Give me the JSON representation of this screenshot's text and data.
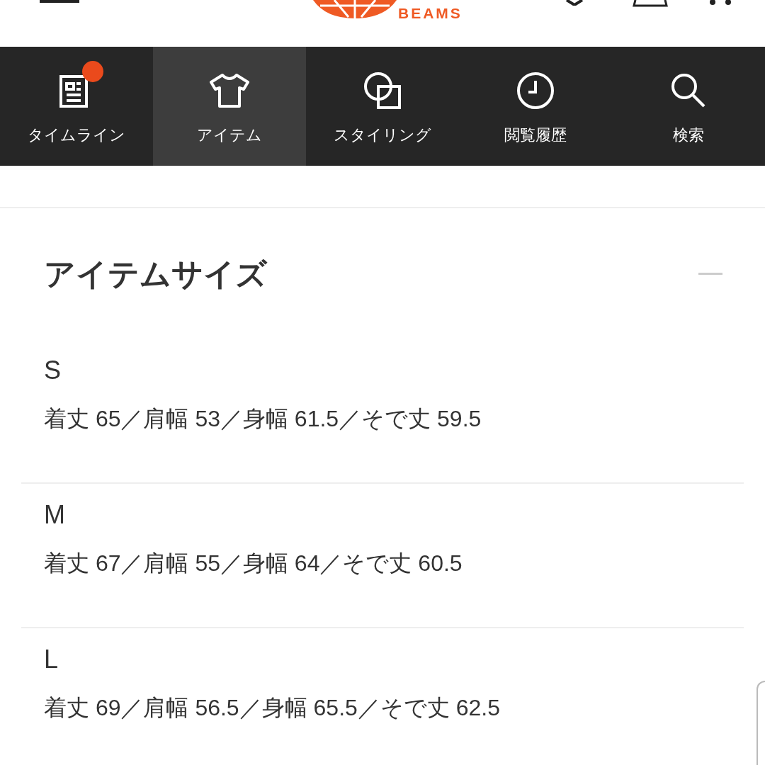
{
  "header": {
    "logo_text": "BEAMS"
  },
  "nav_tabs": [
    {
      "label": "タイムライン",
      "kind": "timeline",
      "selected": false,
      "badge": true
    },
    {
      "label": "アイテム",
      "kind": "item",
      "selected": true,
      "badge": false
    },
    {
      "label": "スタイリング",
      "kind": "styling",
      "selected": false,
      "badge": false
    },
    {
      "label": "閲覧履歴",
      "kind": "history",
      "selected": false,
      "badge": false
    },
    {
      "label": "検索",
      "kind": "search",
      "selected": false,
      "badge": false
    }
  ],
  "size_section": {
    "title": "アイテムサイズ",
    "expanded": true,
    "sizes": [
      {
        "name": "S",
        "measurements": "着丈 65／肩幅 53／身幅 61.5／そで丈 59.5"
      },
      {
        "name": "M",
        "measurements": "着丈 67／肩幅 55／身幅 64／そで丈 60.5"
      },
      {
        "name": "L",
        "measurements": "着丈 69／肩幅 56.5／身幅 65.5／そで丈 62.5"
      }
    ]
  }
}
